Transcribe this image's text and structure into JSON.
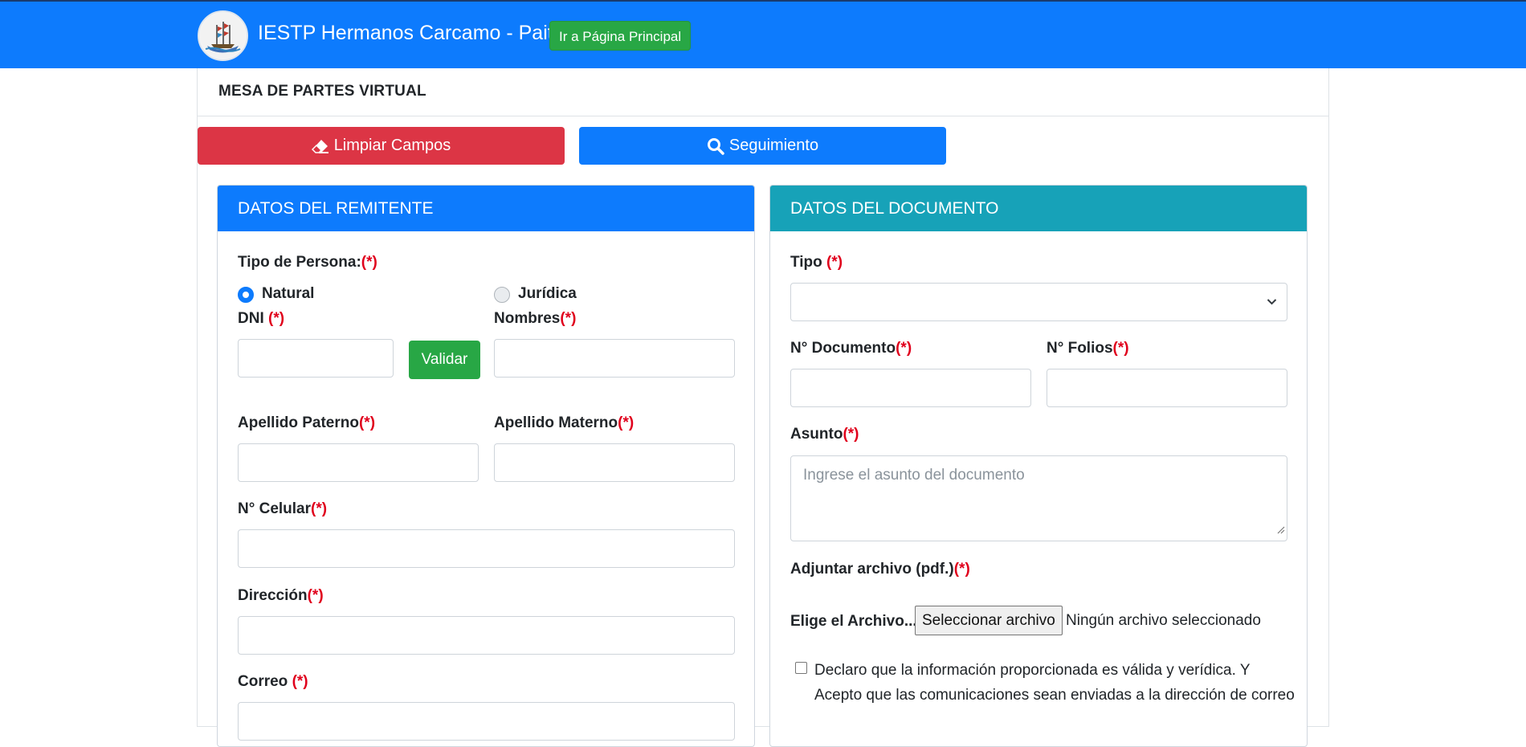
{
  "navbar": {
    "brand": "IESTP Hermanos Carcamo - Paita",
    "home_button": "Ir a Página Principal"
  },
  "page": {
    "title": "MESA DE PARTES VIRTUAL"
  },
  "actions": {
    "clear_label": "Limpiar Campos",
    "track_label": "Seguimiento"
  },
  "sender": {
    "heading": "DATOS DEL REMITENTE",
    "person_type_label": "Tipo de Persona:",
    "person_types": [
      {
        "label": "Natural",
        "selected": true
      },
      {
        "label": "Jurídica",
        "selected": false
      }
    ],
    "dni_label": "DNI",
    "validate_label": "Validar",
    "names_label": "Nombres",
    "paternal_label": "Apellido Paterno",
    "maternal_label": "Apellido Materno",
    "cell_label": "N° Celular",
    "address_label": "Dirección",
    "email_label": "Correo",
    "required_mark": "(*)",
    "required_mark_spaced": " (*)"
  },
  "document": {
    "heading": "DATOS DEL DOCUMENTO",
    "type_label": "Tipo",
    "number_label": "N° Documento",
    "folios_label": "N° Folios",
    "subject_label": "Asunto",
    "subject_placeholder": "Ingrese el asunto del documento",
    "attach_label": "Adjuntar archivo (pdf.)",
    "file_prompt": "Elige el Archivo...",
    "file_button": "Seleccionar archivo",
    "file_status": "Ningún archivo seleccionado",
    "declaration": "Declaro que la información proporcionada es válida y verídica. Y Acepto que las comunicaciones sean enviadas a la dirección de correo"
  },
  "colors": {
    "primary": "#0d7bfd",
    "danger": "#dc3545",
    "success": "#28a745",
    "info": "#17a2b8",
    "required": "#e0001c"
  }
}
